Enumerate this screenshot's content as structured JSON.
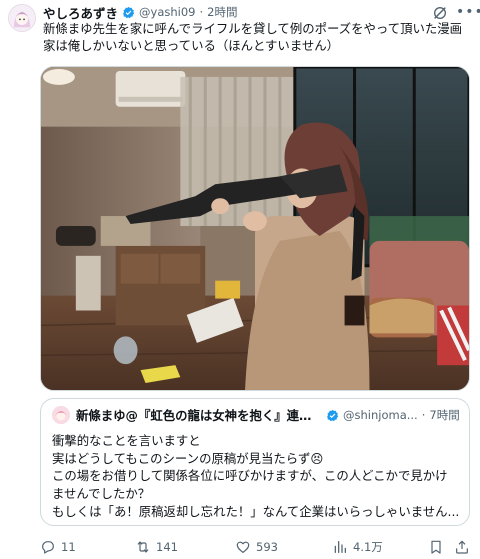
{
  "author": {
    "name": "やしろあずき",
    "handle": "@yashi09",
    "separator": "·",
    "time": "2時間"
  },
  "tweet_text": [
    "新條まゆ先生を家に呼んでライフルを貸して例のポーズをやって頂いた漫画",
    "家は俺しかいないと思っている（ほんとすいません）"
  ],
  "media": {
    "icon": "photo"
  },
  "quoted": {
    "name": "新條まゆ@『虹色の龍は女神を抱く』連載...",
    "handle": "@shinjoma...",
    "separator": "·",
    "time": "7時間",
    "lines": [
      "衝撃的なことを言いますと",
      "実はどうしてもこのシーンの原稿が見当たらず😣",
      "この場をお借りして関係各位に呼びかけますが、この人どこかで見かけ",
      "ませんでしたか？",
      "もしくは「あ！原稿返却し忘れた！」なんて企業はいらっしゃいません..."
    ]
  },
  "actions": {
    "replies": "11",
    "reposts": "141",
    "likes": "593",
    "views": "4.1万"
  },
  "colors": {
    "text": "#0f1419",
    "secondary": "#536471",
    "verified": "#1d9bf0",
    "border": "#cfd9de"
  },
  "icons": [
    "verified-badge-icon",
    "grok-icon",
    "more-icon",
    "reply-icon",
    "repost-icon",
    "like-icon",
    "views-icon",
    "bookmark-icon",
    "share-icon"
  ]
}
